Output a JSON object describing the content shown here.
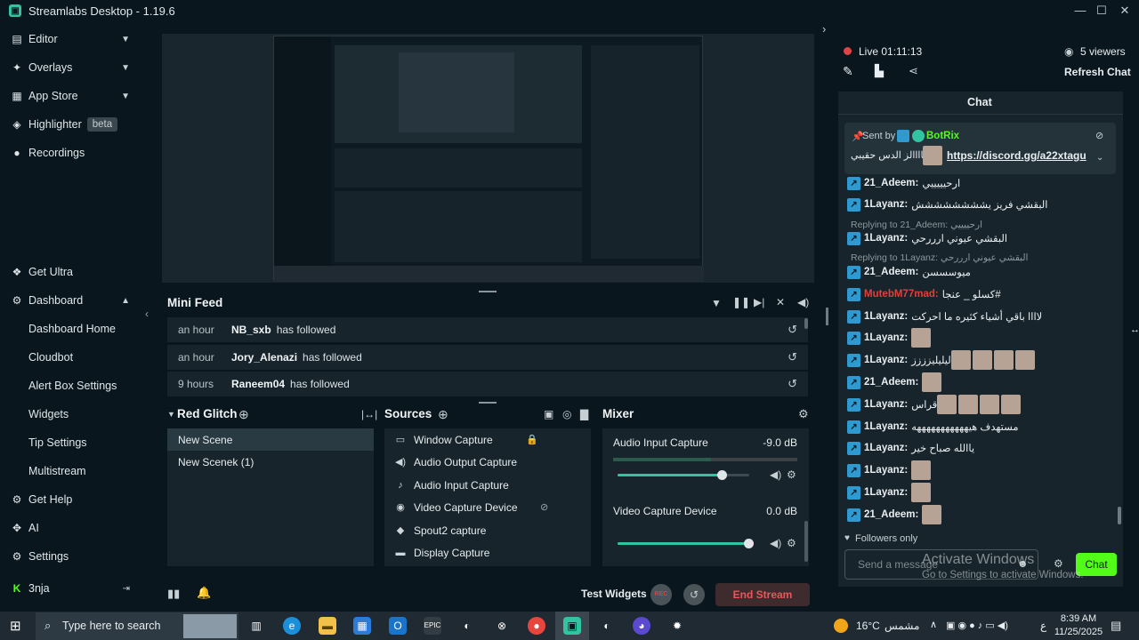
{
  "app": {
    "title": "Streamlabs Desktop - 1.19.6"
  },
  "colors": {
    "accent": "#31c3a2",
    "background": "#09161d",
    "panel": "#17242b",
    "danger": "#e0403b",
    "live_dot": "#e04444"
  },
  "sidebar": {
    "items": [
      {
        "label": "Editor",
        "icon": "editor-icon"
      },
      {
        "label": "Overlays",
        "icon": "overlays-icon"
      },
      {
        "label": "App Store",
        "icon": "app-store-icon"
      },
      {
        "label": "Highlighter",
        "badge": "beta",
        "icon": "highlighter-icon"
      },
      {
        "label": "Recordings",
        "icon": "recordings-icon"
      }
    ],
    "bottom": {
      "get_ultra": "Get Ultra",
      "dashboard": "Dashboard",
      "sub": [
        "Dashboard Home",
        "Cloudbot",
        "Alert Box Settings",
        "Widgets",
        "Tip Settings",
        "Multistream"
      ],
      "get_help": "Get Help",
      "ai": "AI",
      "settings": "Settings",
      "user": "3nja"
    }
  },
  "mini_feed": {
    "title": "Mini Feed",
    "rows": [
      {
        "time": "an hour",
        "name": "NB_sxb",
        "action": "has followed"
      },
      {
        "time": "an hour",
        "name": "Jory_Alenazi",
        "action": "has followed"
      },
      {
        "time": "9 hours",
        "name": "Raneem04",
        "action": "has followed"
      }
    ]
  },
  "scenes": {
    "title": "Red Glitch",
    "items": [
      "New Scene",
      "New Scenek (1)"
    ]
  },
  "sources": {
    "title": "Sources",
    "items": [
      {
        "label": "Window Capture",
        "icon": "window-icon",
        "trail": "lock-icon"
      },
      {
        "label": "Audio Output Capture",
        "icon": "speaker-icon"
      },
      {
        "label": "Audio Input Capture",
        "icon": "mic-icon"
      },
      {
        "label": "Video Capture Device",
        "icon": "camera-icon",
        "trail": "hidden-eye-icon"
      },
      {
        "label": "Spout2 capture",
        "icon": "spout-icon"
      },
      {
        "label": "Display Capture",
        "icon": "monitor-icon"
      }
    ]
  },
  "mixer": {
    "title": "Mixer",
    "channels": [
      {
        "name": "Audio Input Capture",
        "db": "-9.0 dB",
        "level": 0.8
      },
      {
        "name": "Video Capture Device",
        "db": "0.0 dB",
        "level": 1.0
      }
    ]
  },
  "bottombar": {
    "test_widgets": "Test Widgets",
    "rec": "REC",
    "end_stream": "End Stream"
  },
  "live": {
    "label": "Live 01:11:13",
    "viewers": "5 viewers",
    "refresh": "Refresh Chat"
  },
  "chat": {
    "title": "Chat",
    "pinned": {
      "sent_by": "Sent by",
      "bot": "BotRix",
      "text": "تماااالز الدس حقيبي",
      "link": "https://discord.gg/a22xtagu"
    },
    "lines": [
      {
        "user": "21_Adeem:",
        "msg": "ارحيييييي",
        "emotes": 0
      },
      {
        "user": "1Layanz:",
        "msg": "البقشي فريز يشششششششش",
        "emotes": 0
      },
      {
        "reply": "Replying to 21_Adeem: ارحييييي"
      },
      {
        "user": "1Layanz:",
        "msg": "البقشي عيوني ارررحي",
        "emotes": 0
      },
      {
        "reply": "Replying to 1Layanz: البقشي عيوني ارررحي"
      },
      {
        "user": "21_Adeem:",
        "msg": "ميوسسسن",
        "emotes": 0
      },
      {
        "user": "MutebM77mad:",
        "msg": "كسلو _ عنجا#",
        "emotes": 0,
        "red": true
      },
      {
        "user": "1Layanz:",
        "msg": "لاااا باقي أشياء كثيره ما احركت",
        "emotes": 0
      },
      {
        "user": "1Layanz:",
        "msg": "",
        "emotes": 1
      },
      {
        "user": "1Layanz:",
        "msg": "ليليليزززز",
        "emotes": 4
      },
      {
        "user": "21_Adeem:",
        "msg": "",
        "emotes": 1
      },
      {
        "user": "1Layanz:",
        "msg": "قراس",
        "emotes": 4
      },
      {
        "user": "1Layanz:",
        "msg": "مستهدف هيهههههههههههه",
        "emotes": 0
      },
      {
        "user": "1Layanz:",
        "msg": "ياالله صباح خير",
        "emotes": 0
      },
      {
        "user": "1Layanz:",
        "msg": "",
        "emotes": 1
      },
      {
        "user": "1Layanz:",
        "msg": "",
        "emotes": 1
      },
      {
        "user": "21_Adeem:",
        "msg": "",
        "emotes": 1
      }
    ],
    "followers_only": "Followers only",
    "placeholder": "Send a message",
    "send": "Chat",
    "watermark_title": "Activate Windows",
    "watermark_sub": "Go to Settings to activate Windows."
  },
  "taskbar": {
    "search": "Type here to search",
    "weather": "16°C",
    "weather_desc": "مشمس",
    "lang": "ع",
    "time": "8:39 AM",
    "date": "11/25/2025"
  }
}
